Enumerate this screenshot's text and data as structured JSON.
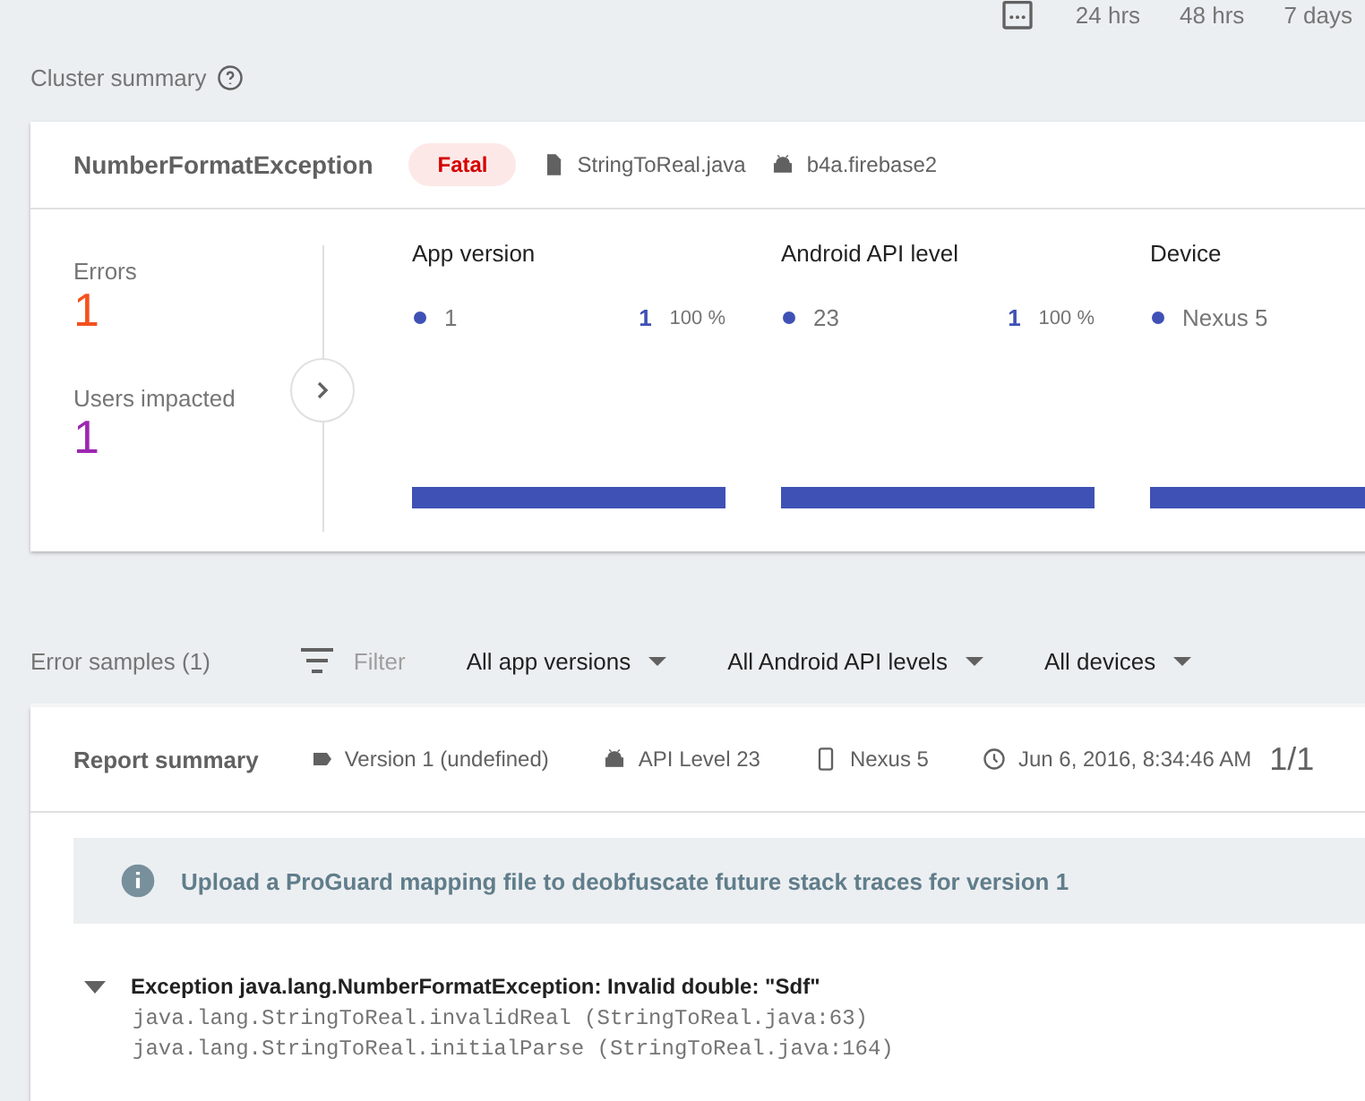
{
  "time_ranges": [
    {
      "label": "24 hrs",
      "selected": false
    },
    {
      "label": "48 hrs",
      "selected": false
    },
    {
      "label": "7 days",
      "selected": false
    }
  ],
  "cluster_summary": {
    "title": "Cluster summary",
    "issue": {
      "name": "NumberFormatException",
      "severity": "Fatal",
      "file": "StringToReal.java",
      "app": "b4a.firebase2"
    },
    "stats": [
      {
        "label": "Errors",
        "value": "1",
        "color": "#f4511e"
      },
      {
        "label": "Users impacted",
        "value": "1",
        "color": "#9c27b0"
      }
    ],
    "breakdowns": [
      {
        "title": "App version",
        "item": "1",
        "count": "1",
        "percent": "100 %",
        "level": 1
      },
      {
        "title": "Android API level",
        "item": "23",
        "count": "1",
        "percent": "100 %",
        "level": 1
      },
      {
        "title": "Device",
        "item": "Nexus 5",
        "level": 1
      }
    ]
  },
  "error_samples": {
    "title": "Error samples (1)",
    "filter": "Filter",
    "dropdowns": [
      "All app versions",
      "All Android API levels",
      "All devices"
    ]
  },
  "report": {
    "title": "Report summary",
    "version": "Version 1 (undefined)",
    "api_level": "API Level 23",
    "device": "Nexus 5",
    "date": "Jun 6, 2016, 8:34:46 AM",
    "page": "1/1",
    "notice": "Upload a ProGuard mapping file to deobfuscate future stack traces for version 1",
    "exception": {
      "title": "Exception java.lang.NumberFormatException: Invalid double: \"Sdf\"",
      "expanded": true,
      "frames": [
        "java.lang.StringToReal.invalidReal (StringToReal.java:63)",
        "java.lang.StringToReal.initialParse (StringToReal.java:164)"
      ]
    }
  }
}
